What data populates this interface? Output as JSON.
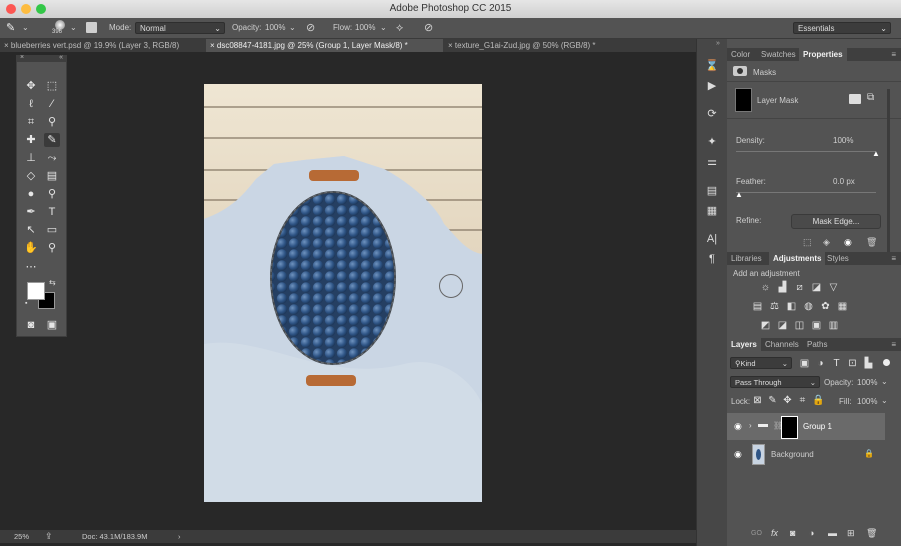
{
  "window": {
    "title": "Adobe Photoshop CC 2015"
  },
  "options_bar": {
    "brush_size": "396",
    "mode_label": "Mode:",
    "mode_value": "Normal",
    "opacity_label": "Opacity:",
    "opacity_value": "100%",
    "flow_label": "Flow:",
    "flow_value": "100%",
    "workspace_value": "Essentials"
  },
  "tabs": [
    {
      "label": "blueberries vert.psd @ 19.9% (Layer 3, RGB/8)"
    },
    {
      "label": "dsc08847-4181.jpg @ 25% (Group 1, Layer Mask/8) *"
    },
    {
      "label": "texture_G1ai-Zud.jpg @ 50% (RGB/8) *"
    }
  ],
  "status": {
    "zoom": "25%",
    "doc": "Doc: 43.1M/183.9M",
    "arrow": "›"
  },
  "properties_panel": {
    "tabs": [
      "Color",
      "Swatches",
      "Properties"
    ],
    "header": "Masks",
    "mask_label": "Layer Mask",
    "density_label": "Density:",
    "density_value": "100%",
    "density_level": 1.0,
    "feather_label": "Feather:",
    "feather_value": "0.0 px",
    "feather_level": 0.0,
    "refine_label": "Refine:",
    "mask_edge_button": "Mask Edge..."
  },
  "adjustments_panel": {
    "tabs": [
      "Libraries",
      "Adjustments",
      "Styles"
    ],
    "header": "Add an adjustment"
  },
  "layers_panel": {
    "tabs": [
      "Layers",
      "Channels",
      "Paths"
    ],
    "filter_value": "Kind",
    "blend_value": "Pass Through",
    "opacity_label": "Opacity:",
    "opacity_value": "100%",
    "lock_label": "Lock:",
    "fill_label": "Fill:",
    "fill_value": "100%",
    "layers": [
      {
        "name": "Group 1"
      },
      {
        "name": "Background"
      }
    ],
    "footer_icons": [
      "GO",
      "fx"
    ]
  },
  "colors": {
    "accent": "#3f3f3f",
    "panel": "#535353",
    "canvas_bg": "#282828"
  }
}
